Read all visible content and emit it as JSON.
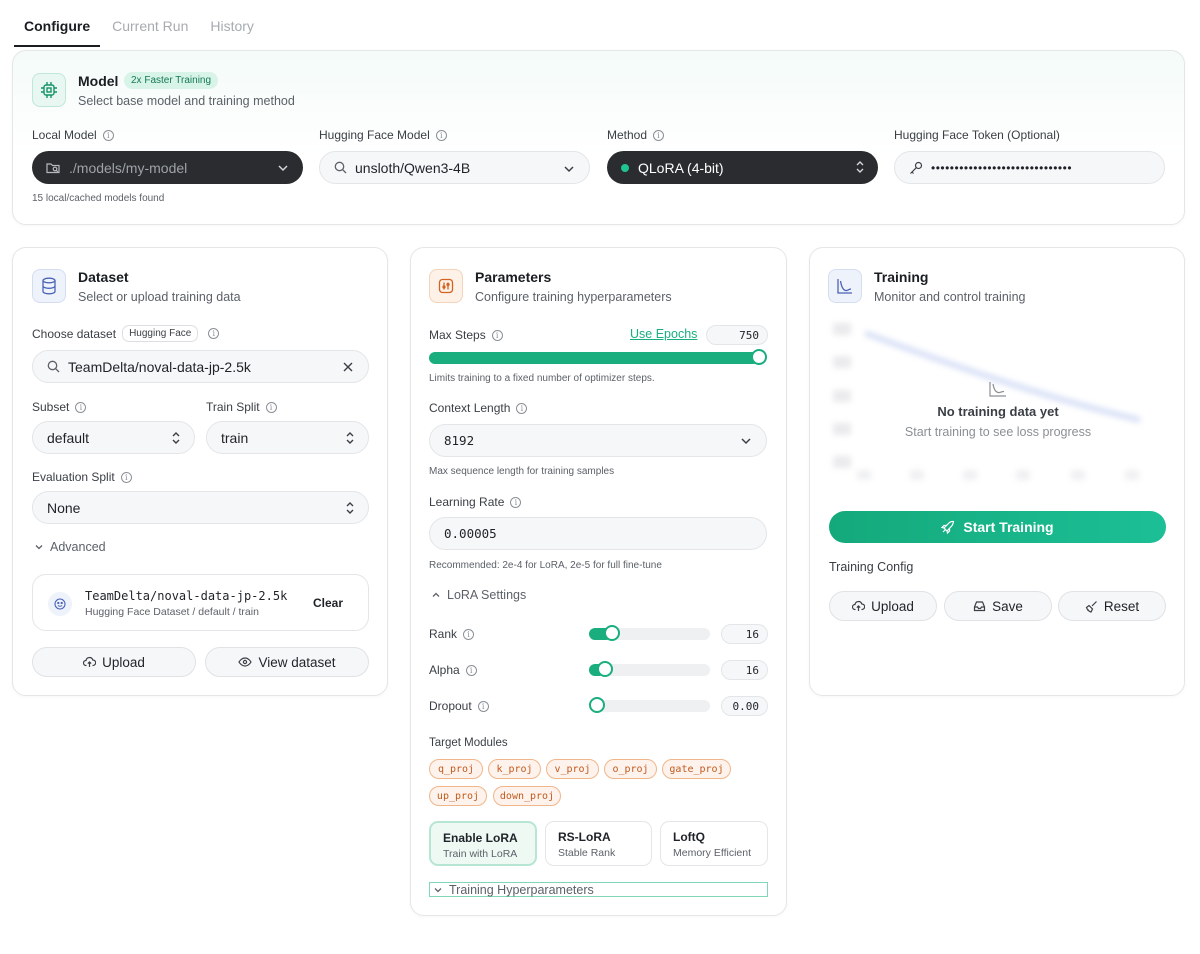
{
  "tabs": [
    {
      "label": "Configure",
      "active": true
    },
    {
      "label": "Current Run",
      "active": false
    },
    {
      "label": "History",
      "active": false
    }
  ],
  "model": {
    "title": "Model",
    "badge": "2x Faster Training",
    "subtitle": "Select base model and training method",
    "local_model_label": "Local Model",
    "local_model_placeholder": "./models/my-model",
    "local_model_hint": "15 local/cached models found",
    "hf_model_label": "Hugging Face Model",
    "hf_model_value": "unsloth/Qwen3-4B",
    "method_label": "Method",
    "method_value": "QLoRA (4-bit)",
    "token_label": "Hugging Face Token (Optional)",
    "token_value": "••••••••••••••••••••••••••••••"
  },
  "dataset": {
    "title": "Dataset",
    "subtitle": "Select or upload training data",
    "choose_label": "Choose dataset",
    "source_badge": "Hugging Face",
    "search_value": "TeamDelta/noval-data-jp-2.5k",
    "subset_label": "Subset",
    "subset_value": "default",
    "train_split_label": "Train Split",
    "train_split_value": "train",
    "eval_split_label": "Evaluation Split",
    "eval_split_value": "None",
    "advanced_label": "Advanced",
    "selected_name": "TeamDelta/noval-data-jp-2.5k",
    "selected_meta": "Hugging Face Dataset / default / train",
    "clear_label": "Clear",
    "upload_label": "Upload",
    "view_label": "View dataset"
  },
  "params": {
    "title": "Parameters",
    "subtitle": "Configure training hyperparameters",
    "max_steps_label": "Max Steps",
    "use_epochs_label": "Use Epochs",
    "max_steps_value": "750",
    "max_steps_fraction": 1.0,
    "max_steps_hint": "Limits training to a fixed number of optimizer steps.",
    "context_label": "Context Length",
    "context_value": "8192",
    "context_hint": "Max sequence length for training samples",
    "lr_label": "Learning Rate",
    "lr_value": "0.00005",
    "lr_hint": "Recommended: 2e-4 for LoRA, 2e-5 for full fine-tune",
    "lora_settings_label": "LoRA Settings",
    "rank_label": "Rank",
    "rank_value": "16",
    "rank_fraction": 0.14,
    "alpha_label": "Alpha",
    "alpha_value": "16",
    "alpha_fraction": 0.08,
    "dropout_label": "Dropout",
    "dropout_value": "0.00",
    "dropout_fraction": 0.0,
    "target_modules_label": "Target Modules",
    "modules": [
      "q_proj",
      "k_proj",
      "v_proj",
      "o_proj",
      "gate_proj",
      "up_proj",
      "down_proj"
    ],
    "options": [
      {
        "title": "Enable LoRA",
        "sub": "Train with LoRA",
        "active": true
      },
      {
        "title": "RS-LoRA",
        "sub": "Stable Rank",
        "active": false
      },
      {
        "title": "LoftQ",
        "sub": "Memory Efficient",
        "active": false
      }
    ],
    "hyper_label": "Training Hyperparameters"
  },
  "training": {
    "title": "Training",
    "subtitle": "Monitor and control training",
    "empty_title": "No training data yet",
    "empty_sub": "Start training to see loss progress",
    "start_label": "Start Training",
    "config_label": "Training Config",
    "upload_label": "Upload",
    "save_label": "Save",
    "reset_label": "Reset"
  },
  "colors": {
    "accent": "#1aae7f",
    "dark": "#2a2c2f",
    "chip_orange": "#c2591c"
  }
}
